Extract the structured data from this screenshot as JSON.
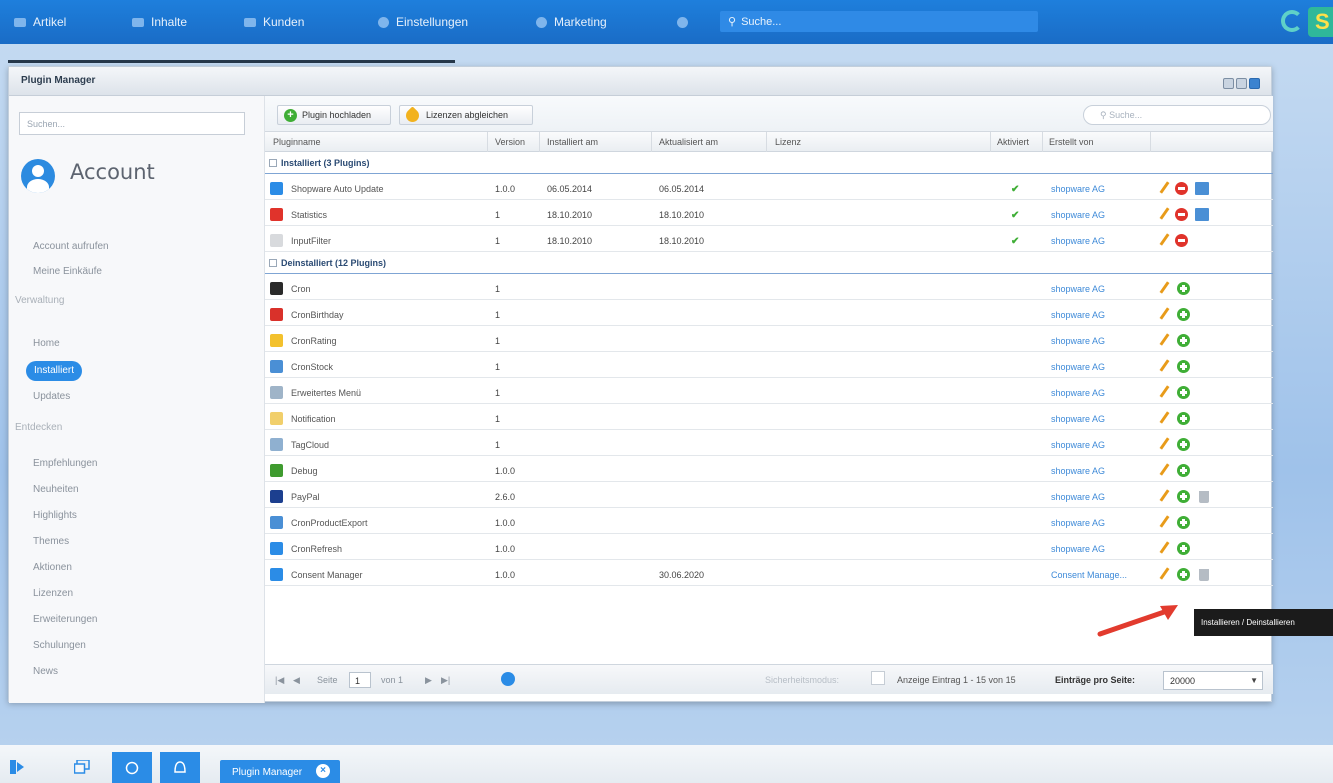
{
  "topnav": {
    "items": [
      {
        "label": "Artikel",
        "icon": "article-icon"
      },
      {
        "label": "Inhalte",
        "icon": "content-icon"
      },
      {
        "label": "Kunden",
        "icon": "customers-icon"
      },
      {
        "label": "Einstellungen",
        "icon": "settings-icon"
      },
      {
        "label": "Marketing",
        "icon": "marketing-icon"
      }
    ],
    "help_icon": "help-icon",
    "search_placeholder": "Suche..."
  },
  "window": {
    "title": "Plugin Manager"
  },
  "sidebar": {
    "search_placeholder": "Suchen...",
    "account_title": "Account",
    "items_account": [
      "Account aufrufen",
      "Meine Einkäufe"
    ],
    "group_verwaltung": "Verwaltung",
    "items_verwaltung": [
      "Home",
      "Installiert",
      "Updates"
    ],
    "group_entdecken": "Entdecken",
    "items_entdecken": [
      "Empfehlungen",
      "Neuheiten",
      "Highlights",
      "Themes",
      "Aktionen",
      "Lizenzen",
      "Erweiterungen",
      "Schulungen",
      "News"
    ]
  },
  "toolbar": {
    "upload_label": "Plugin hochladen",
    "licenses_label": "Lizenzen abgleichen",
    "search_placeholder": "Suche..."
  },
  "table": {
    "headers": [
      "Pluginname",
      "Version",
      "Installiert am",
      "Aktualisiert am",
      "Lizenz",
      "Aktiviert",
      "Erstellt von"
    ],
    "group_installed": "Installiert (3 Plugins)",
    "group_uninstalled": "Deinstalliert (12 Plugins)",
    "installed": [
      {
        "name": "Shopware Auto Update",
        "version": "1.0.0",
        "installed": "06.05.2014",
        "updated": "06.05.2014",
        "active": true,
        "author": "shopware AG",
        "color": "#2b8ce6"
      },
      {
        "name": "Statistics",
        "version": "1",
        "installed": "18.10.2010",
        "updated": "18.10.2010",
        "active": true,
        "author": "shopware AG",
        "color": "#e0332b"
      },
      {
        "name": "InputFilter",
        "version": "1",
        "installed": "18.10.2010",
        "updated": "18.10.2010",
        "active": true,
        "author": "shopware AG",
        "color": "#d8dadd"
      }
    ],
    "uninstalled": [
      {
        "name": "Cron",
        "version": "1",
        "updated": "",
        "author": "shopware AG",
        "color": "#2a2a2a",
        "trash": false
      },
      {
        "name": "CronBirthday",
        "version": "1",
        "updated": "",
        "author": "shopware AG",
        "color": "#d9312a",
        "trash": false
      },
      {
        "name": "CronRating",
        "version": "1",
        "updated": "",
        "author": "shopware AG",
        "color": "#f3c12d",
        "trash": false
      },
      {
        "name": "CronStock",
        "version": "1",
        "updated": "",
        "author": "shopware AG",
        "color": "#4a8fd5",
        "trash": false
      },
      {
        "name": "Erweitertes Menü",
        "version": "1",
        "updated": "",
        "author": "shopware AG",
        "color": "#9fb4c8",
        "trash": false
      },
      {
        "name": "Notification",
        "version": "1",
        "updated": "",
        "author": "shopware AG",
        "color": "#f1cf6b",
        "trash": false
      },
      {
        "name": "TagCloud",
        "version": "1",
        "updated": "",
        "author": "shopware AG",
        "color": "#8fb0d0",
        "trash": false
      },
      {
        "name": "Debug",
        "version": "1.0.0",
        "updated": "",
        "author": "shopware AG",
        "color": "#3f9b2f",
        "trash": false
      },
      {
        "name": "PayPal",
        "version": "2.6.0",
        "updated": "",
        "author": "shopware AG",
        "color": "#1c3f8f",
        "trash": true
      },
      {
        "name": "CronProductExport",
        "version": "1.0.0",
        "updated": "",
        "author": "shopware AG",
        "color": "#4a8fd5",
        "trash": false
      },
      {
        "name": "CronRefresh",
        "version": "1.0.0",
        "updated": "",
        "author": "shopware AG",
        "color": "#2b8ce6",
        "trash": false
      },
      {
        "name": "Consent Manager",
        "version": "1.0.0",
        "updated": "30.06.2020",
        "author": "Consent Manage...",
        "color": "#2b8ce6",
        "trash": true
      }
    ]
  },
  "pager": {
    "page_label": "Seite",
    "page_value": "1",
    "of_label": "von 1",
    "safe_mode_label": "Sicherheitsmodus:",
    "display_text": "Anzeige Eintrag 1 - 15 von 15",
    "per_page_label": "Einträge pro Seite:",
    "per_page_value": "20000"
  },
  "tooltip": "Installieren / Deinstallieren",
  "taskbar": {
    "window_label": "Plugin Manager"
  },
  "colors": {
    "accent": "#2b8ce6",
    "install_green": "#3fae36",
    "delete_red": "#e0332b",
    "annotation_arrow": "#e23b2e"
  }
}
